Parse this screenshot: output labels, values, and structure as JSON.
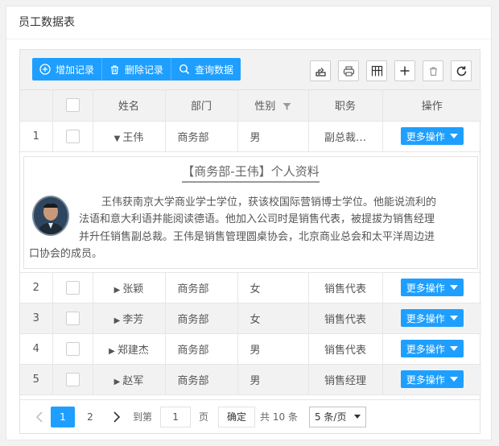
{
  "page": {
    "title": "员工数据表"
  },
  "toolbar": {
    "add_label": "增加记录",
    "delete_label": "删除记录",
    "query_label": "查询数据"
  },
  "table": {
    "headers": {
      "name": "姓名",
      "dept": "部门",
      "gender": "性别",
      "job": "职务",
      "action": "操作"
    },
    "rows": [
      {
        "index": "1",
        "name": "王伟",
        "dept": "商务部",
        "gender": "男",
        "job": "副总裁…",
        "action": "更多操作"
      },
      {
        "index": "2",
        "name": "张颖",
        "dept": "商务部",
        "gender": "女",
        "job": "销售代表",
        "action": "更多操作"
      },
      {
        "index": "3",
        "name": "李芳",
        "dept": "商务部",
        "gender": "女",
        "job": "销售代表",
        "action": "更多操作"
      },
      {
        "index": "4",
        "name": "郑建杰",
        "dept": "商务部",
        "gender": "男",
        "job": "销售代表",
        "action": "更多操作"
      },
      {
        "index": "5",
        "name": "赵军",
        "dept": "商务部",
        "gender": "男",
        "job": "销售经理",
        "action": "更多操作"
      }
    ]
  },
  "detail": {
    "title": "【商务部-王伟】个人资料",
    "line1": "王伟获南京大学商业学士学位，获该校国际营销博士学位。他能说流利的",
    "line2": "法语和意大利语并能阅读德语。他加入公司时是销售代表，被提拔为销售经理",
    "line3": "并升任销售副总裁。王伟是销售管理圆桌协会，北京商业总会和太平洋周边进",
    "line4": "口协会的成员。"
  },
  "pager": {
    "page1": "1",
    "page2": "2",
    "goto_label": "到第",
    "goto_value": "1",
    "page_unit": "页",
    "confirm": "确定",
    "total": "共 10 条",
    "page_size": "5 条/页"
  },
  "colors": {
    "primary": "#1e9fff",
    "header_bg": "#f2f2f2"
  }
}
